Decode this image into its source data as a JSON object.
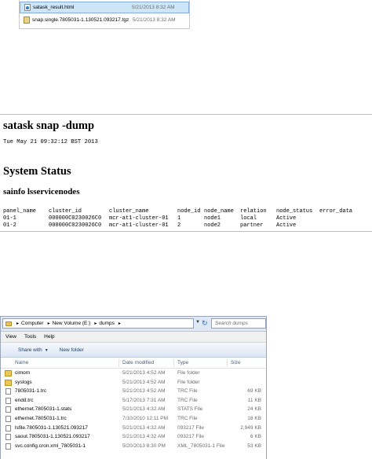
{
  "top_files": [
    {
      "name": "satask_result.html",
      "date": "5/21/2013 8:32 AM",
      "icon": "html-file-icon",
      "selected": true
    },
    {
      "name": "snap.single.7805031-1.130521.093217.tgz",
      "date": "5/21/2013 8:32 AM",
      "icon": "archive-file-icon",
      "selected": false
    }
  ],
  "snap": {
    "title": "satask snap -dump",
    "date": "Tue May 21 09:32:12 BST 2013",
    "section_title": "System Status",
    "sub_title": "sainfo lsservicenodes",
    "table": {
      "headers": [
        "panel_name",
        "cluster_id",
        "cluster_name",
        "node_id",
        "node_name",
        "relation",
        "node_status",
        "error_data"
      ],
      "rows": [
        [
          "01-1",
          "000000C0230026C0",
          "mcr-at1-cluster-01",
          "1",
          "node1",
          "local",
          "Active",
          ""
        ],
        [
          "01-2",
          "000000C0230026C0",
          "mcr-at1-cluster-01",
          "2",
          "node2",
          "partner",
          "Active",
          ""
        ]
      ]
    }
  },
  "explorer": {
    "breadcrumb": [
      "Computer",
      "New Volume (E:)",
      "dumps"
    ],
    "search_placeholder": "Search dumps",
    "menu": [
      "View",
      "Tools",
      "Help"
    ],
    "commands": {
      "share": "Share with",
      "new_folder": "New folder"
    },
    "columns": {
      "name": "Name",
      "modified": "Date modified",
      "type": "Type",
      "size": "Size"
    },
    "files": [
      {
        "name": "cimom",
        "modified": "5/21/2013 4:52 AM",
        "type": "File folder",
        "size": "",
        "kind": "folder"
      },
      {
        "name": "syslogs",
        "modified": "5/21/2013 4:52 AM",
        "type": "File folder",
        "size": "",
        "kind": "folder"
      },
      {
        "name": "7805031-1.trc",
        "modified": "5/21/2013 4:52 AM",
        "type": "TRC File",
        "size": "69 KB",
        "kind": "file"
      },
      {
        "name": "endd.trc",
        "modified": "5/17/2013 7:31 AM",
        "type": "TRC File",
        "size": "11 KB",
        "kind": "file"
      },
      {
        "name": "ethernet.7805031-1.stats",
        "modified": "5/21/2013 4:32 AM",
        "type": "STATS File",
        "size": "24 KB",
        "kind": "file"
      },
      {
        "name": "ethernet.7805031-1.trc",
        "modified": "7/10/2010 12:11 PM",
        "type": "TRC File",
        "size": "18 KB",
        "kind": "file"
      },
      {
        "name": "lsfile.7805031-1.130521.093217",
        "modified": "5/21/2013 4:32 AM",
        "type": "093217 File",
        "size": "2,949 KB",
        "kind": "file"
      },
      {
        "name": "saout.7805031-1.130521.093217",
        "modified": "5/21/2013 4:32 AM",
        "type": "093217 File",
        "size": "6 KB",
        "kind": "file"
      },
      {
        "name": "svc.config.cron.xml_7805031-1",
        "modified": "5/20/2013 8:30 PM",
        "type": "XML_7805031-1 File",
        "size": "53 KB",
        "kind": "file"
      }
    ]
  }
}
